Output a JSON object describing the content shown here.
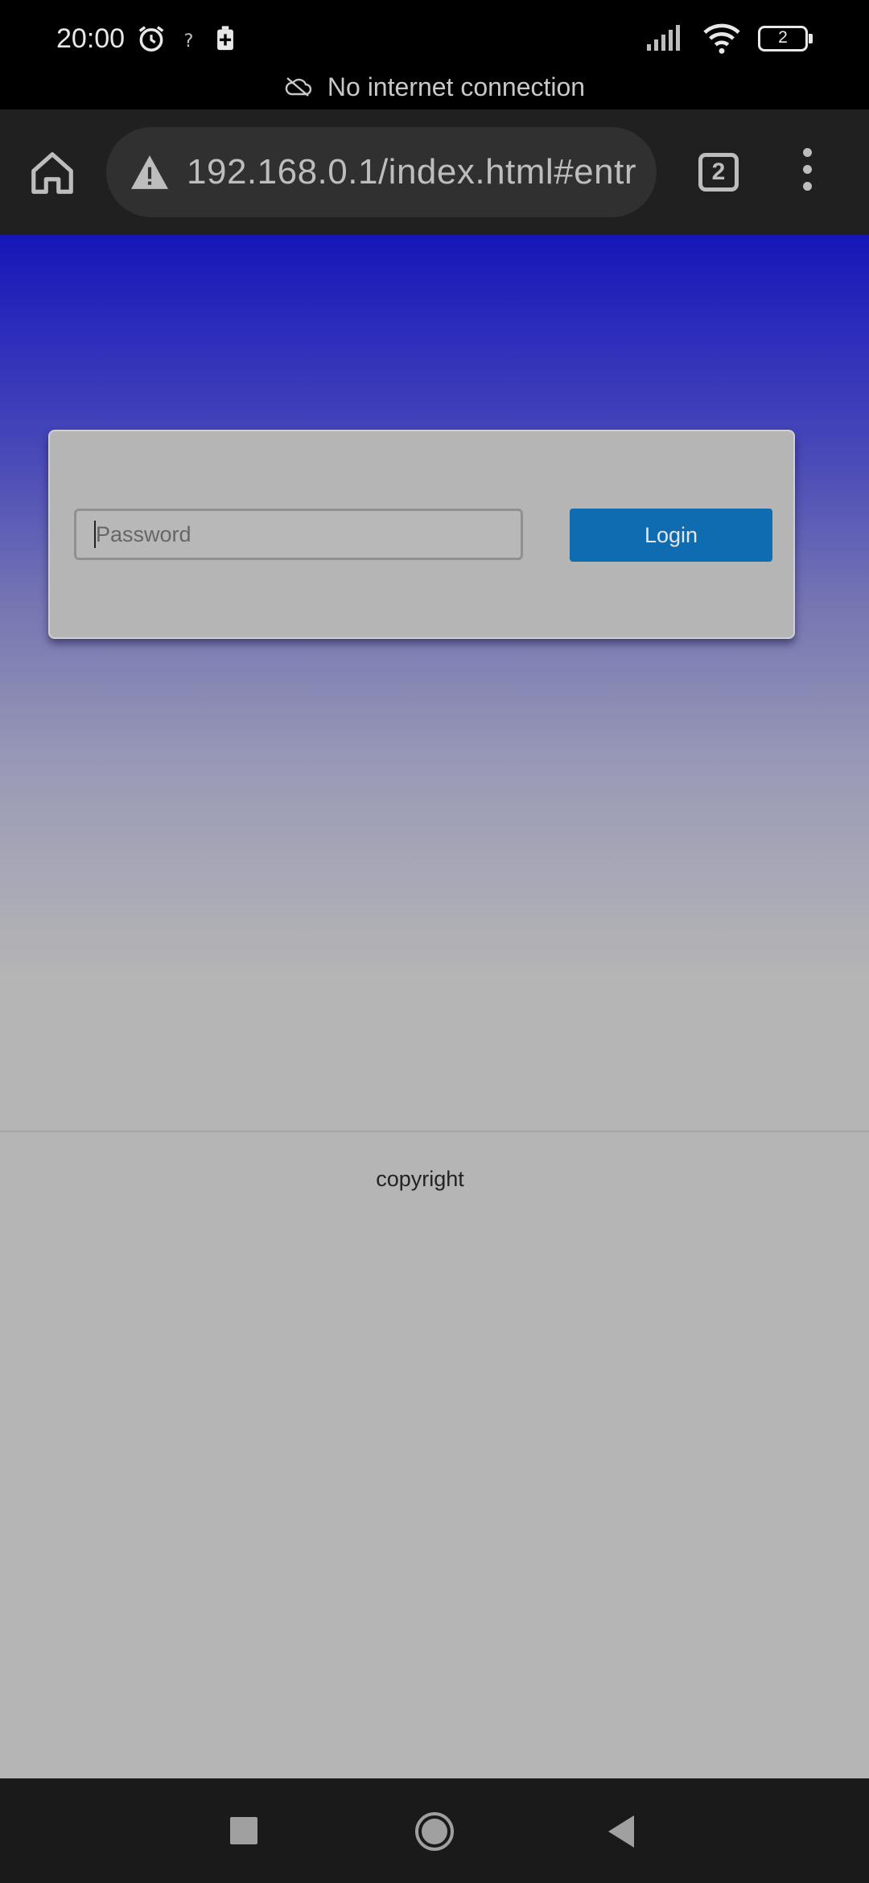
{
  "status_bar": {
    "time": "20:00",
    "battery_level": "2",
    "icons": [
      "alarm-icon",
      "wifi-help-icon",
      "battery-saver-icon",
      "signal-icon",
      "wifi-icon",
      "battery-icon"
    ]
  },
  "offline_banner": {
    "text": "No internet connection",
    "icon": "cloud-off-icon"
  },
  "browser": {
    "url": "192.168.0.1/index.html#entr",
    "tab_count": "2",
    "icons": [
      "home-icon",
      "warning-icon",
      "tabs-icon",
      "more-vert-icon"
    ]
  },
  "login": {
    "password_placeholder": "Password",
    "login_label": "Login"
  },
  "footer": {
    "copyright": "copyright"
  },
  "colors": {
    "gradient_top": "#1616b8",
    "page_bg": "#b5b5b5",
    "login_button": "#0f6cb0",
    "toolbar": "#202020"
  },
  "nav_bar": {
    "icons": [
      "recents-icon",
      "home-circle-icon",
      "back-icon"
    ]
  }
}
